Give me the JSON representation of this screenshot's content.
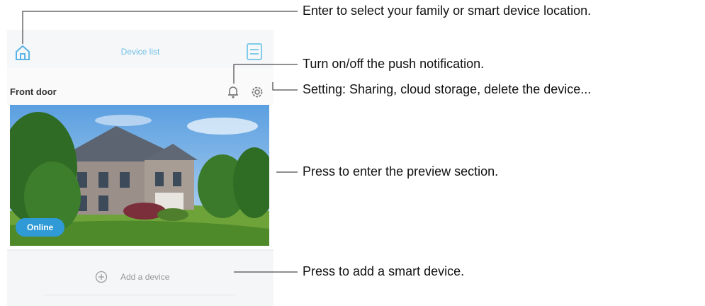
{
  "app": {
    "title": "Device list",
    "device": {
      "name": "Front door",
      "status": "Online"
    },
    "add_device_label": "Add a device"
  },
  "callouts": {
    "home": "Enter to select your family or smart device location.",
    "notification": "Turn on/off the push notification.",
    "settings": "Setting: Sharing, cloud storage, delete the device...",
    "preview": "Press to enter the preview section.",
    "add": "Press to add a smart device."
  },
  "colors": {
    "accent": "#2f9ad6",
    "title": "#6fbfe6"
  },
  "icons": [
    "home-icon",
    "menu-icon",
    "bell-icon",
    "gear-icon",
    "plus-circle-icon"
  ]
}
